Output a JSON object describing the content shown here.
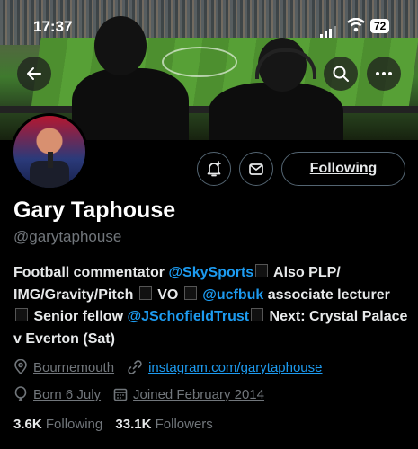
{
  "status_bar": {
    "time": "17:37",
    "battery": "72"
  },
  "header": {
    "back_icon": "arrow-left-icon",
    "search_icon": "search-icon",
    "more_icon": "more-dots-icon"
  },
  "actions": {
    "notify_icon": "bell-plus-icon",
    "message_icon": "envelope-icon",
    "follow_label": "Following"
  },
  "profile": {
    "name": "Gary Taphouse",
    "handle": "@garytaphouse",
    "bio": {
      "p1": "Football commentator ",
      "m1": "@SkySports",
      "p2": " Also PLP/ IMG/Gravity/Pitch ",
      "p3": " VO ",
      "m2": "@ucfbuk",
      "p4": " associate lecturer ",
      "p5": " Senior fellow ",
      "m3": "@JSchofieldTrust",
      "p6": " Next: Crystal Palace v Everton (Sat)"
    },
    "location": "Bournemouth",
    "website": "instagram.com/garytaphouse",
    "birthday": "Born 6 July",
    "joined": "Joined February 2014",
    "following_count": "3.6K",
    "following_label": "Following",
    "followers_count": "33.1K",
    "followers_label": "Followers"
  },
  "colors": {
    "accent": "#1d9bf0",
    "muted": "#71767b",
    "text": "#e7e9ea",
    "background": "#000000"
  }
}
